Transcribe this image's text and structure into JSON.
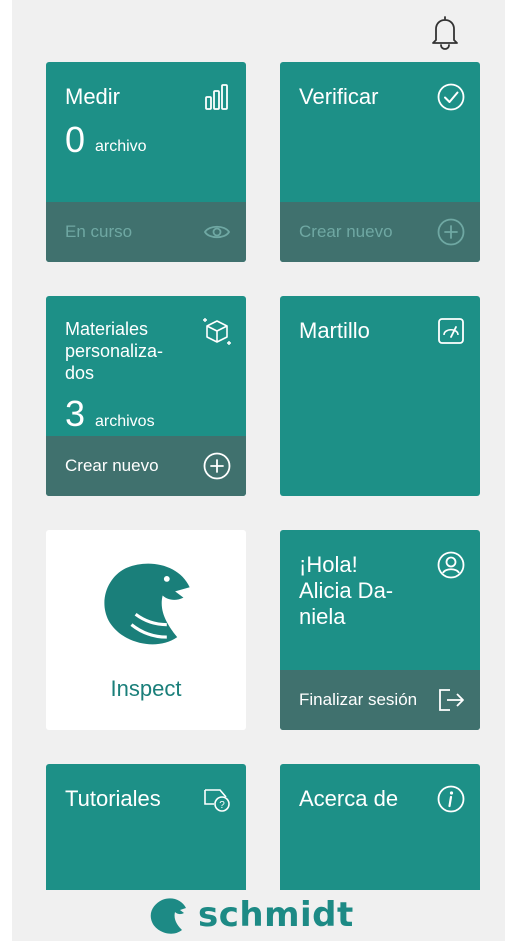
{
  "header": {
    "bell_icon": "notification-bell-icon"
  },
  "tiles": {
    "medir": {
      "title": "Medir",
      "count": "0",
      "count_unit": "archivo",
      "footer_label": "En curso",
      "icon": "bar-chart-icon",
      "footer_icon": "eye-icon"
    },
    "verificar": {
      "title": "Verificar",
      "footer_label": "Crear nuevo",
      "icon": "check-circle-icon",
      "footer_icon": "plus-circle-icon"
    },
    "materiales": {
      "title": "Materiales\npersonaliza-\ndos",
      "count": "3",
      "count_unit": "archivos",
      "footer_label": "Crear nuevo",
      "icon": "cube-icon",
      "footer_icon": "plus-circle-icon"
    },
    "martillo": {
      "title": "Martillo",
      "icon": "gauge-icon"
    },
    "inspect": {
      "label": "Inspect",
      "icon": "eagle-logo"
    },
    "user": {
      "title": "¡Hola!\nAlicia Da-\nniela",
      "footer_label": "Finalizar sesión",
      "icon": "user-circle-icon",
      "footer_icon": "logout-icon"
    },
    "tutoriales": {
      "title": "Tutoriales",
      "icon": "help-tag-icon"
    },
    "acerca": {
      "title": "Acerca de",
      "icon": "info-circle-icon"
    }
  },
  "brand": {
    "name": "schmidt"
  },
  "colors": {
    "tile": "#1d9087",
    "footer": "#40716e",
    "background": "#f0f0f0",
    "brand": "#1d8a85"
  }
}
